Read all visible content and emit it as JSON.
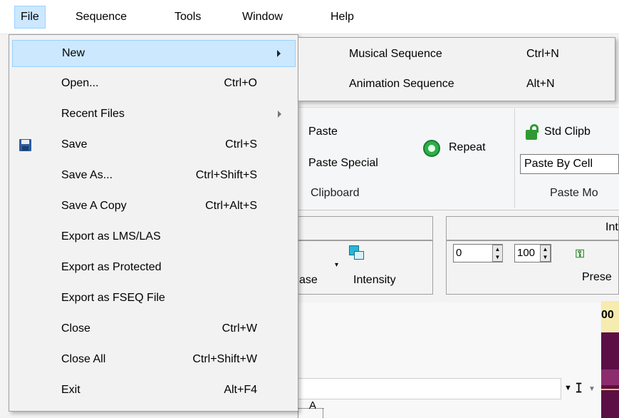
{
  "menubar": {
    "items": [
      "File",
      "Sequence",
      "Tools",
      "Window",
      "Help"
    ]
  },
  "file_menu": {
    "items": [
      {
        "label": "New",
        "shortcut": "",
        "submenu": true
      },
      {
        "label": "Open...",
        "shortcut": "Ctrl+O"
      },
      {
        "label": "Recent Files",
        "shortcut": "",
        "submenu": true
      },
      {
        "label": "Save",
        "shortcut": "Ctrl+S",
        "icon": "save-icon"
      },
      {
        "label": "Save As...",
        "shortcut": "Ctrl+Shift+S"
      },
      {
        "label": "Save A Copy",
        "shortcut": "Ctrl+Alt+S"
      },
      {
        "label": "Export as LMS/LAS",
        "shortcut": ""
      },
      {
        "label": "Export as Protected",
        "shortcut": ""
      },
      {
        "label": "Export as FSEQ File",
        "shortcut": ""
      },
      {
        "label": "Close",
        "shortcut": "Ctrl+W"
      },
      {
        "label": "Close All",
        "shortcut": "Ctrl+Shift+W"
      },
      {
        "label": "Exit",
        "shortcut": "Alt+F4"
      }
    ]
  },
  "new_submenu": {
    "items": [
      {
        "label": "Musical Sequence",
        "shortcut": "Ctrl+N"
      },
      {
        "label": "Animation Sequence",
        "shortcut": "Alt+N"
      }
    ]
  },
  "ribbon": {
    "paste": "Paste",
    "paste_special": "Paste Special",
    "repeat": "Repeat",
    "clipboard_group": "Clipboard",
    "std_clipboard": "Std Clipb",
    "paste_by_cell": "Paste By Cell",
    "paste_mode_group": "Paste Mo"
  },
  "intensity_panel": {
    "header_partial": "Int",
    "spin_min": "0",
    "spin_max": "100",
    "preset": "Prese",
    "ease_partial": "ase",
    "intensity": "Intensity"
  },
  "grid": {
    "timeline_partial": "00",
    "row_a": "A"
  },
  "colors": {
    "accent_highlight": "#cce8ff",
    "timeline_dark": "#5c0f45"
  }
}
